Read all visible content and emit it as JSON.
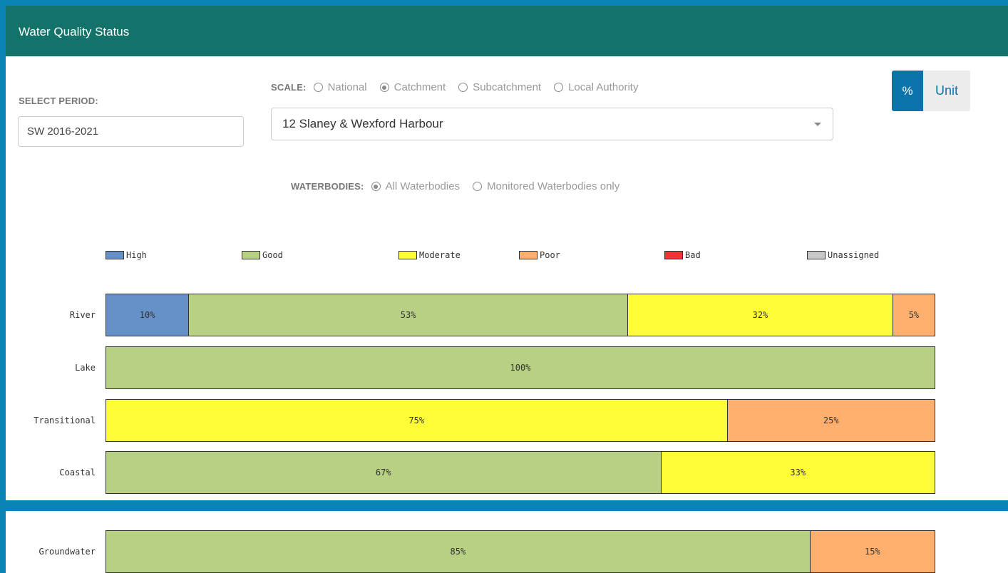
{
  "header": {
    "title": "Water Quality Status"
  },
  "period": {
    "label": "SELECT PERIOD:",
    "value": "SW 2016-2021"
  },
  "scale": {
    "label": "SCALE:",
    "options": [
      {
        "label": "National",
        "checked": false
      },
      {
        "label": "Catchment",
        "checked": true
      },
      {
        "label": "Subcatchment",
        "checked": false
      },
      {
        "label": "Local Authority",
        "checked": false
      }
    ]
  },
  "catchment": {
    "selected": "12 Slaney & Wexford Harbour"
  },
  "unit_toggle": {
    "percent_label": "%",
    "unit_label": "Unit",
    "active": "%"
  },
  "waterbodies": {
    "label": "WATERBODIES:",
    "options": [
      {
        "label": "All Waterbodies",
        "checked": true
      },
      {
        "label": "Monitored Waterbodies only",
        "checked": false
      }
    ]
  },
  "chart_data": {
    "type": "bar",
    "orientation": "horizontal",
    "stacked": true,
    "categories": [
      "River",
      "Lake",
      "Transitional",
      "Coastal",
      "Groundwater"
    ],
    "series": [
      {
        "name": "High",
        "color": "#6590c8",
        "values": [
          10,
          0,
          0,
          0,
          0
        ]
      },
      {
        "name": "Good",
        "color": "#b8d083",
        "values": [
          53,
          100,
          0,
          67,
          85
        ]
      },
      {
        "name": "Moderate",
        "color": "#fffd37",
        "values": [
          32,
          0,
          75,
          33,
          0
        ]
      },
      {
        "name": "Poor",
        "color": "#ffb06e",
        "values": [
          5,
          0,
          25,
          0,
          15
        ]
      },
      {
        "name": "Bad",
        "color": "#ee3437",
        "values": [
          0,
          0,
          0,
          0,
          0
        ]
      },
      {
        "name": "Unassigned",
        "color": "#c8c8c8",
        "values": [
          0,
          0,
          0,
          0,
          0
        ]
      }
    ],
    "value_suffix": "%",
    "xlim": [
      0,
      100
    ],
    "legend": "top"
  }
}
